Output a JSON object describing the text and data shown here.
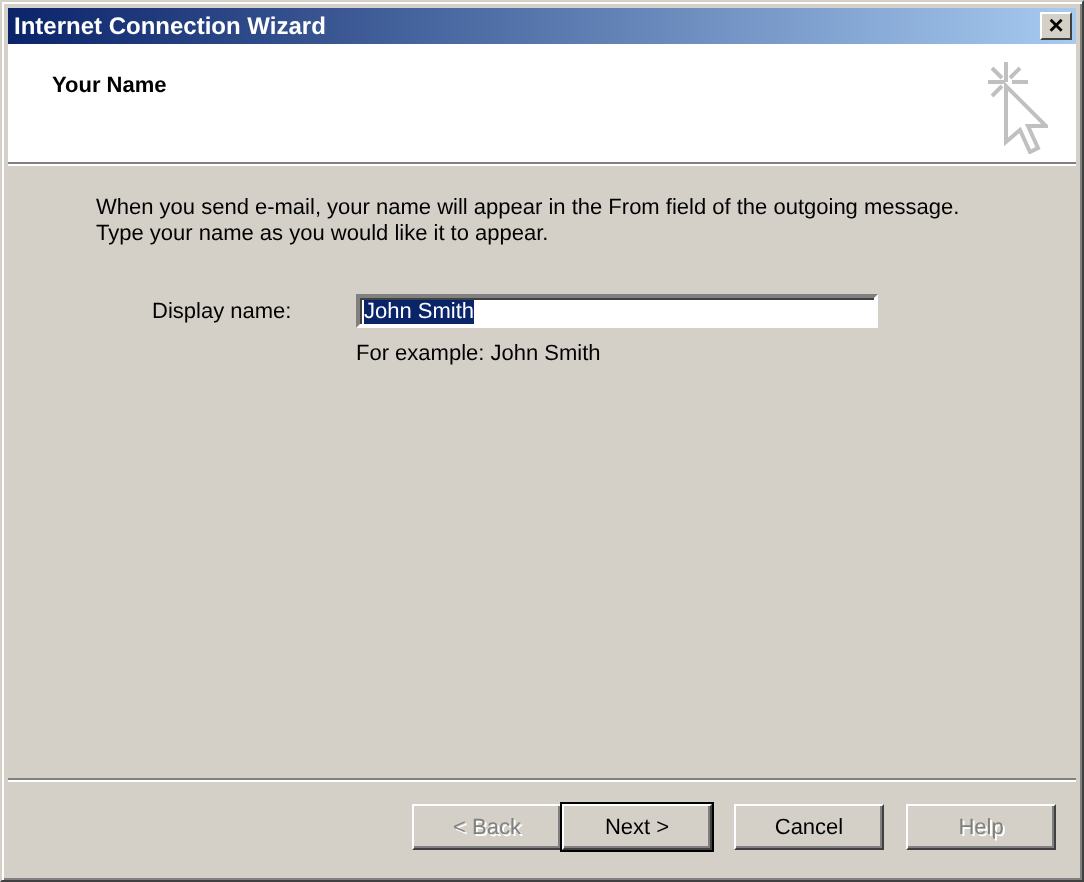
{
  "window": {
    "title": "Internet Connection Wizard",
    "close": "×"
  },
  "header": {
    "title": "Your Name"
  },
  "intro": [
    "When you send e-mail, your name will appear in the From field of the outgoing message.",
    "Type your name as you would like it to appear."
  ],
  "field": {
    "label": "Display name:",
    "value": "John Smith",
    "selected": true,
    "hint": "For example: John Smith"
  },
  "buttons": [
    {
      "label": "< Back",
      "disabled": true,
      "default": false
    },
    {
      "label": "Next >",
      "disabled": false,
      "default": true
    },
    {
      "label": "Cancel",
      "disabled": false,
      "default": false
    },
    {
      "label": "Help",
      "disabled": true,
      "default": false
    }
  ]
}
